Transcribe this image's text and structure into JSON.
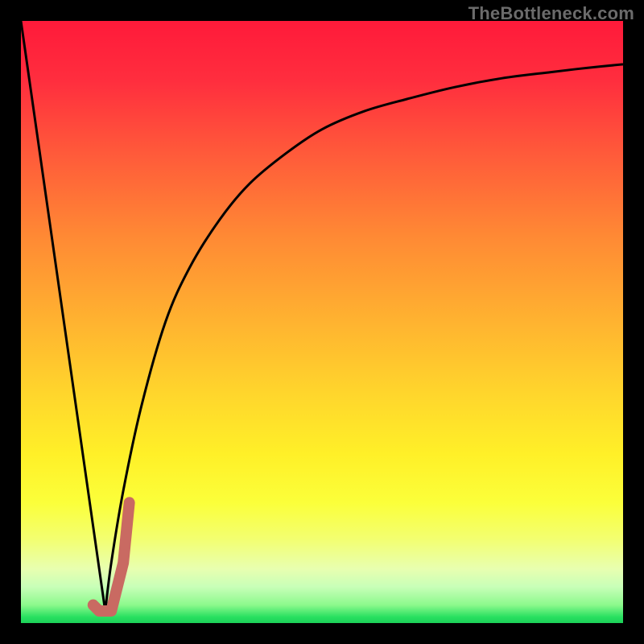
{
  "watermark": {
    "text": "TheBottleneck.com"
  },
  "colors": {
    "frame": "#000000",
    "curve": "#000000",
    "highlight": "#c96a62",
    "gradient_top": "#ff1a3a",
    "gradient_mid": "#ffd62c",
    "gradient_bottom": "#1cd058"
  },
  "chart_data": {
    "type": "line",
    "title": "",
    "xlabel": "",
    "ylabel": "",
    "xlim": [
      0,
      100
    ],
    "ylim": [
      0,
      100
    ],
    "grid": false,
    "legend": false,
    "series": [
      {
        "name": "descending-line",
        "kind": "line",
        "x": [
          0,
          14
        ],
        "y": [
          100,
          2
        ]
      },
      {
        "name": "ascending-curve",
        "kind": "line",
        "x": [
          14,
          15,
          17,
          20,
          24,
          28,
          33,
          38,
          44,
          50,
          57,
          64,
          72,
          80,
          88,
          94,
          100
        ],
        "y": [
          2,
          10,
          22,
          36,
          50,
          59,
          67,
          73,
          78,
          82,
          85,
          87,
          89,
          90.5,
          91.5,
          92.2,
          92.8
        ]
      },
      {
        "name": "highlight-j",
        "kind": "line",
        "x": [
          12,
          13,
          15,
          17,
          18
        ],
        "y": [
          3,
          2,
          2,
          10,
          20
        ]
      }
    ],
    "annotations": []
  }
}
